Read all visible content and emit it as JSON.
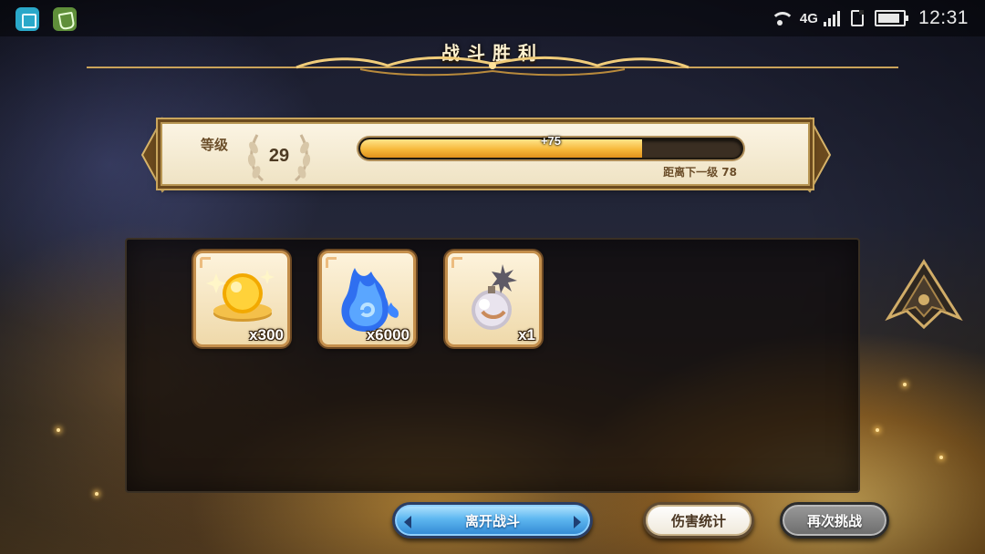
{
  "status_bar": {
    "network_label": "4G",
    "time": "12:31",
    "battery_level": 0.9,
    "signal_bars": 4,
    "notification_icons": [
      "gallery-icon",
      "security-icon"
    ],
    "status_icons": [
      "wifi-icon",
      "signal-icon",
      "sim-icon",
      "battery-icon"
    ]
  },
  "result": {
    "title": "战斗胜利"
  },
  "level": {
    "label": "等级",
    "value": "29",
    "xp_gain": "+75",
    "xp_progress": 0.74,
    "next_level_text": "距离下一级 78"
  },
  "rewards": [
    {
      "icon": "gold-coin-icon",
      "count": "x300"
    },
    {
      "icon": "blue-flame-icon",
      "count": "x6000"
    },
    {
      "icon": "bomb-orb-icon",
      "count": "x1"
    }
  ],
  "buttons": {
    "leave": "离开战斗",
    "damage_stats": "伤害统计",
    "retry": "再次挑战"
  },
  "colors": {
    "xp_fill": "#f6b83a",
    "leave_button": "#5eb7f0",
    "retry_button": "#6c6c6c",
    "frame_gold": "#c9a55c"
  }
}
